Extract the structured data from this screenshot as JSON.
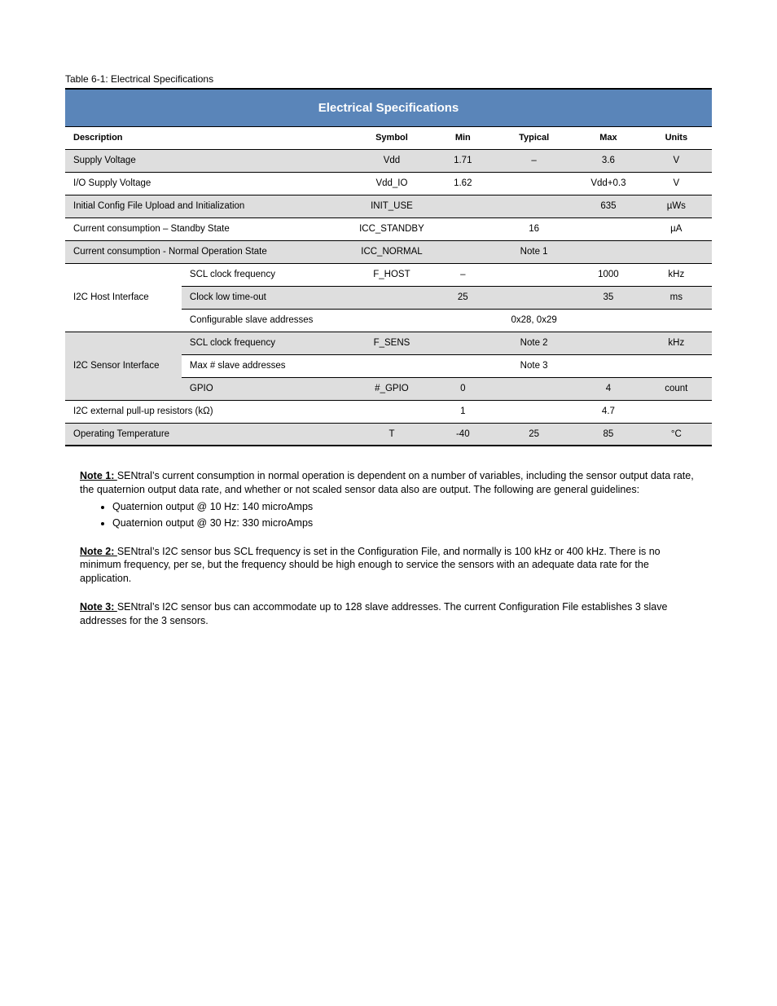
{
  "table_caption": "Table 6-1: Electrical Specifications",
  "banner": "Electrical Specifications",
  "headers": {
    "description": "Description",
    "symbol": "Symbol",
    "min": "Min",
    "typical": "Typical",
    "max": "Max",
    "units": "Units"
  },
  "row_supply": {
    "descr": "Supply Voltage",
    "symbol": "Vdd",
    "min": "1.71",
    "typical": "–",
    "max": "3.6",
    "units": "V"
  },
  "row_vddio": {
    "descr": "I/O Supply Voltage",
    "symbol": "Vdd_IO",
    "min": "1.62",
    "typical": "",
    "max": "Vdd+0.3",
    "units": "V"
  },
  "row_inituse": {
    "descr": "Initial Config File Upload and Initialization",
    "symbol": "INIT_USE",
    "min": "",
    "typical": "",
    "max": "635",
    "units": "µWs"
  },
  "row_iccstand": {
    "descr": "Current consumption – Standby State",
    "symbol": "ICC_STANDBY",
    "min": "",
    "typical": "16",
    "max": "",
    "units": "µA"
  },
  "row_iccnorm": {
    "descr": "Current consumption - Normal Operation State",
    "symbol": "ICC_NORMAL",
    "min": "",
    "typical": "Note 1",
    "max": "",
    "units": ""
  },
  "group_host": {
    "label": "I2C Host Interface",
    "rows": {
      "sclfreq": {
        "descr": "SCL clock frequency",
        "symbol": "F_HOST",
        "min": "–",
        "typical": "",
        "max": "1000",
        "units": "kHz"
      },
      "tout": {
        "descr": "Clock low time-out",
        "symbol": "",
        "min": "25",
        "typical": "",
        "max": "35",
        "units": "ms"
      },
      "addr": {
        "descr": "Configurable slave addresses",
        "symbol": "",
        "min": "",
        "typical": "0x28, 0x29",
        "max": "",
        "units": ""
      }
    }
  },
  "group_sensor": {
    "label": "I2C Sensor Interface",
    "rows": {
      "sclfreq": {
        "descr": "SCL clock frequency",
        "symbol": "F_SENS",
        "min": "",
        "typical": "Note 2",
        "max": "",
        "units": "kHz"
      },
      "addr": {
        "descr": "Max # slave addresses",
        "symbol": "",
        "min": "",
        "typical": "Note 3",
        "max": "",
        "units": ""
      },
      "gpio": {
        "descr": "GPIO",
        "symbol": "#_GPIO",
        "min": "0",
        "typical": "",
        "max": "4",
        "units": "count"
      }
    }
  },
  "row_pullup": {
    "descr": "I2C external pull-up resistors (kΩ)",
    "symbol": "",
    "min": "1",
    "typical": "",
    "max": "4.7",
    "units": ""
  },
  "row_temp": {
    "descr": "Operating Temperature",
    "symbol": "T",
    "min": "-40",
    "typical": "25",
    "max": "85",
    "units": "°C"
  },
  "footnotes": {
    "note1": {
      "lead": "Note 1: ",
      "body_a": "SENtral’s current consumption in normal operation is dependent on a number of variables, including the sensor output data rate, the quaternion output data rate, and whether or not scaled sensor data also are output. The following are general guidelines:",
      "li1": "Quaternion output @ 10 Hz: 140 microAmps",
      "li2": "Quaternion output @ 30 Hz: 330 microAmps"
    },
    "note2": {
      "lead": "Note 2: ",
      "body": "SENtral’s I2C sensor bus SCL frequency is set in the Configuration File, and normally is 100 kHz or 400 kHz. There is no minimum frequency, per se, but the frequency should be high enough to service the sensors with an adequate data rate for the application."
    },
    "note3": {
      "lead": "Note 3: ",
      "body": "SENtral’s I2C sensor bus can accommodate up to 128 slave addresses. The current Configuration File establishes 3 slave addresses for the 3 sensors."
    }
  }
}
